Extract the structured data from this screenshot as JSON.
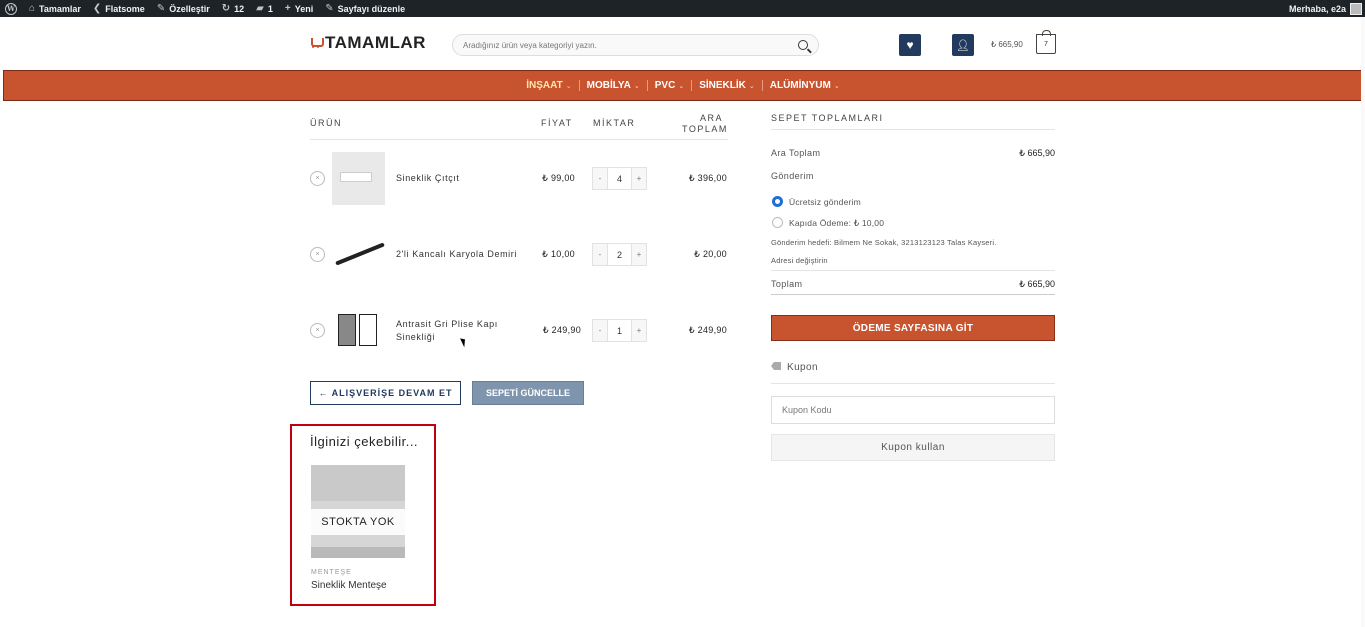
{
  "adminbar": {
    "wp_icon": "wordpress-icon",
    "site": "Tamamlar",
    "theme": "Flatsome",
    "customize": "Özelleştir",
    "updates": "12",
    "comments": "1",
    "new": "Yeni",
    "edit_page": "Sayfayı düzenle",
    "greeting": "Merhaba, e2a"
  },
  "header": {
    "logo": "TAMAMLAR",
    "search_placeholder": "Aradığınız ürün veya kategoriyi yazın.",
    "cart_total": "₺ 665,90",
    "cart_count": "7"
  },
  "nav": {
    "items": [
      "İNŞAAT",
      "MOBİLYA",
      "PVC",
      "SİNEKLİK",
      "ALÜMİNYUM"
    ]
  },
  "cart": {
    "headers": {
      "product": "ÜRÜN",
      "price": "FİYAT",
      "qty": "MİKTAR",
      "subtotal_1": "ARA",
      "subtotal_2": "TOPLAM"
    },
    "rows": [
      {
        "name": "Sineklik Çıtçıt",
        "price": "₺ 99,00",
        "qty": "4",
        "subtotal": "₺ 396,00"
      },
      {
        "name": "2'li Kancalı Karyola Demiri",
        "price": "₺ 10,00",
        "qty": "2",
        "subtotal": "₺ 20,00"
      },
      {
        "name": "Antrasit Gri Plise Kapı Sinekliği",
        "price": "₺ 249,90",
        "qty": "1",
        "subtotal": "₺ 249,90"
      }
    ],
    "remove_symbol": "×",
    "minus": "-",
    "plus": "+",
    "continue_label": "← ALIŞVERİŞE DEVAM ET",
    "update_label": "SEPETİ GÜNCELLE"
  },
  "related": {
    "title": "İlginizi çekebilir...",
    "stock_label": "STOKTA YOK",
    "category": "MENTEŞE",
    "name": "Sineklik Menteşe"
  },
  "totals": {
    "title": "SEPET TOPLAMLARI",
    "subtotal_label": "Ara Toplam",
    "subtotal_value": "₺ 665,90",
    "shipping_label": "Gönderim",
    "option_free": "Ücretsiz gönderim",
    "option_cod": "Kapıda Ödeme: ₺ 10,00",
    "ship_to": "Gönderim hedefi: Bilmem Ne Sokak, 3213123123 Talas Kayseri.",
    "change_address": "Adresi değiştirin",
    "total_label": "Toplam",
    "total_value": "₺ 665,90",
    "checkout_label": "ÖDEME SAYFASINA GİT",
    "coupon_heading": "Kupon",
    "coupon_placeholder": "Kupon Kodu",
    "coupon_button": "Kupon kullan"
  }
}
